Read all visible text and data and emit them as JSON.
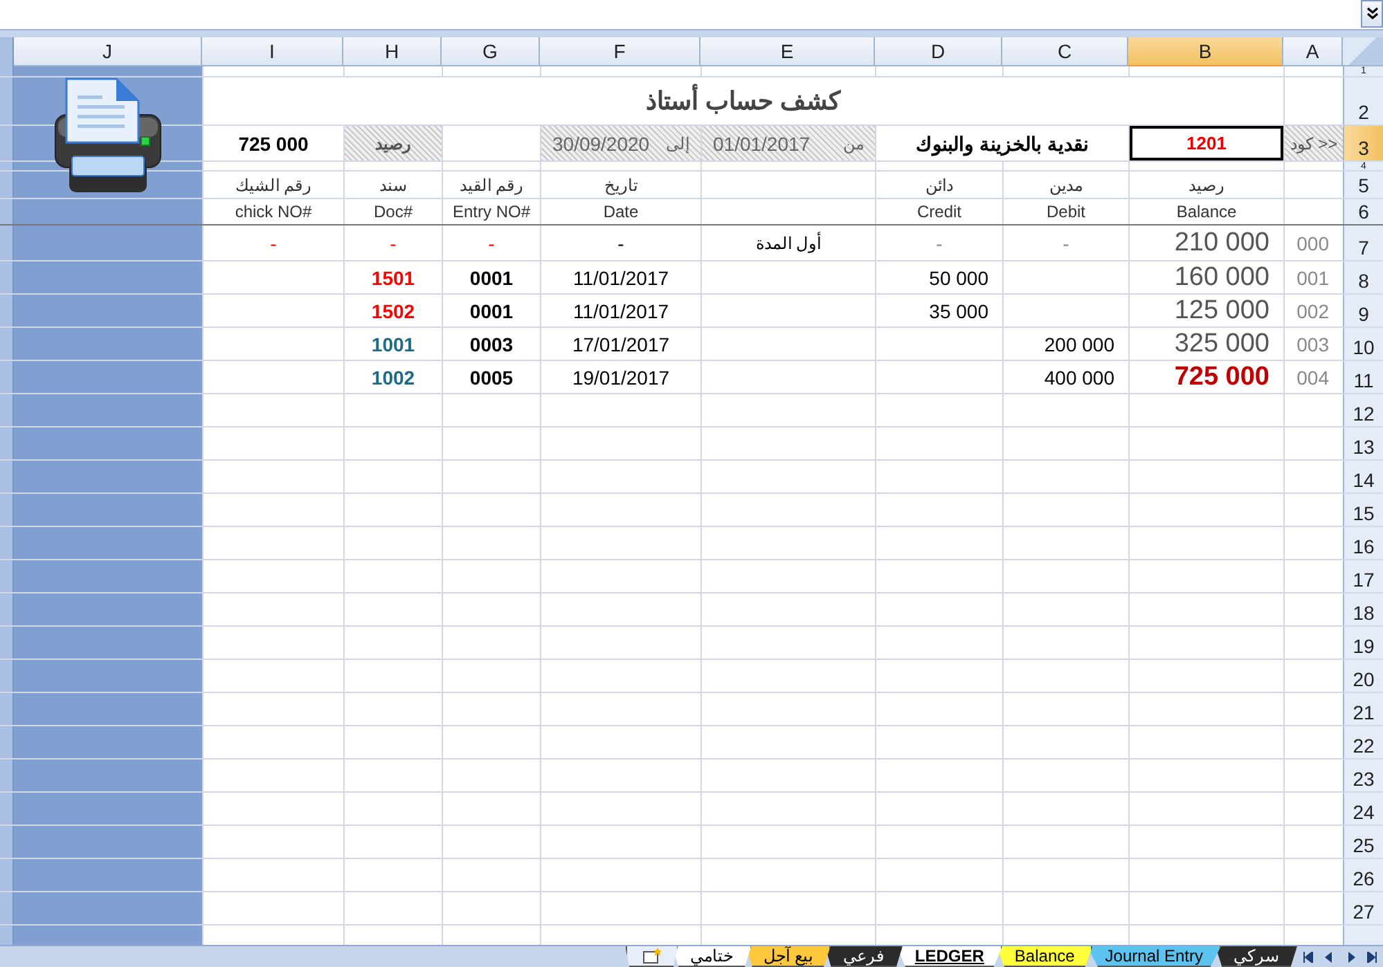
{
  "column_headers": [
    {
      "label": "J",
      "selected": false
    },
    {
      "label": "I",
      "selected": false
    },
    {
      "label": "H",
      "selected": false
    },
    {
      "label": "G",
      "selected": false
    },
    {
      "label": "F",
      "selected": false
    },
    {
      "label": "E",
      "selected": false
    },
    {
      "label": "D",
      "selected": false
    },
    {
      "label": "C",
      "selected": false
    },
    {
      "label": "B",
      "selected": true
    },
    {
      "label": "A",
      "selected": false
    }
  ],
  "row_headers": [
    {
      "label": "1",
      "selected": false
    },
    {
      "label": "2",
      "selected": false
    },
    {
      "label": "3",
      "selected": true
    },
    {
      "label": "4",
      "selected": false
    },
    {
      "label": "5",
      "selected": false
    },
    {
      "label": "6",
      "selected": false
    },
    {
      "label": "7",
      "selected": false
    },
    {
      "label": "8",
      "selected": false
    },
    {
      "label": "9",
      "selected": false
    },
    {
      "label": "10",
      "selected": false
    },
    {
      "label": "11",
      "selected": false
    },
    {
      "label": "12",
      "selected": false
    },
    {
      "label": "13",
      "selected": false
    },
    {
      "label": "14",
      "selected": false
    },
    {
      "label": "15",
      "selected": false
    },
    {
      "label": "16",
      "selected": false
    },
    {
      "label": "17",
      "selected": false
    },
    {
      "label": "18",
      "selected": false
    },
    {
      "label": "19",
      "selected": false
    },
    {
      "label": "20",
      "selected": false
    },
    {
      "label": "21",
      "selected": false
    },
    {
      "label": "22",
      "selected": false
    },
    {
      "label": "23",
      "selected": false
    },
    {
      "label": "24",
      "selected": false
    },
    {
      "label": "25",
      "selected": false
    },
    {
      "label": "26",
      "selected": false
    },
    {
      "label": "27",
      "selected": false
    }
  ],
  "title": "كشف حساب أستاذ",
  "header": {
    "balance": "725 000",
    "balance_label": "رصيد",
    "to_date": "30/09/2020",
    "to_label": "إلى",
    "from_date": "01/01/2017",
    "from_label": "من",
    "account_name": "نقدية بالخزينة والبنوك",
    "code": "1201",
    "code_label": "كود >>"
  },
  "arabic_headings": [
    "رصيد",
    "مدين",
    "دائن",
    "تاريخ",
    "رقم القيد",
    "سند",
    "رقم الشيك"
  ],
  "english_headings": [
    "chick NO#",
    "Doc#",
    "Entry NO#",
    "Date",
    "Credit",
    "Debit",
    "Balance"
  ],
  "rows": [
    {
      "kind": "opening",
      "cheque": "-",
      "doc": "-",
      "entry": "-",
      "date": "-",
      "description": "أول المدة",
      "credit": "-",
      "debit": "-",
      "balance": "210 000",
      "code": "000",
      "color": "#ff0000",
      "highlight": false
    },
    {
      "kind": "entry",
      "doc": "1501",
      "entry": "0001",
      "date": "11/01/2017",
      "credit": "50 000",
      "balance": "160 000",
      "code": "001",
      "color": "#ff0000",
      "highlight": false
    },
    {
      "kind": "entry",
      "doc": "1502",
      "entry": "0001",
      "date": "11/01/2017",
      "credit": "35 000",
      "balance": "125 000",
      "code": "002",
      "color": "#ff0000",
      "highlight": false
    },
    {
      "kind": "entry",
      "doc": "1001",
      "entry": "0003",
      "date": "17/01/2017",
      "debit": "200 000",
      "balance": "325 000",
      "code": "003",
      "color": "#1c6b8a",
      "highlight": false
    },
    {
      "kind": "entry",
      "doc": "1002",
      "entry": "0005",
      "date": "19/01/2017",
      "debit": "400 000",
      "balance": "725 000",
      "code": "004",
      "color": "#1c6b8a",
      "highlight": true
    }
  ],
  "sheet_tabs": [
    {
      "label": "سركي",
      "selected": false,
      "color": "#2b2b2b"
    },
    {
      "label": "Journal Entry",
      "selected": false,
      "color": "#5cc3ef"
    },
    {
      "label": "Balance",
      "selected": false,
      "color": "#ffff3c"
    },
    {
      "label": "LEDGER",
      "selected": true,
      "color": "#ffffff"
    },
    {
      "label": "فرعي",
      "selected": false,
      "color": "#2b2b2b"
    },
    {
      "label": "بيع آجل",
      "selected": false,
      "color": "#ffc83c"
    },
    {
      "label": "ختامي",
      "selected": false,
      "color": "#ffffff"
    }
  ]
}
